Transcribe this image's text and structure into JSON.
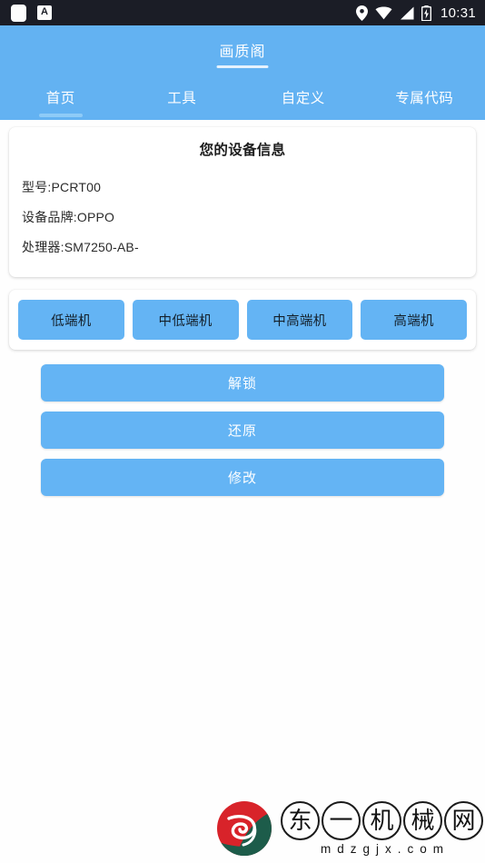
{
  "status_bar": {
    "left_icons": [
      "app-square-icon",
      "a-badge-icon"
    ],
    "a_badge_label": "A",
    "right_icons": [
      "location-pin-icon",
      "wifi-icon",
      "cellular-signal-icon",
      "battery-charging-icon"
    ],
    "clock": "10:31"
  },
  "app_bar": {
    "title": "画质阁"
  },
  "tabs": [
    {
      "label": "首页",
      "active": true
    },
    {
      "label": "工具",
      "active": false
    },
    {
      "label": "自定义",
      "active": false
    },
    {
      "label": "专属代码",
      "active": false
    }
  ],
  "device_info": {
    "title": "您的设备信息",
    "rows": [
      "型号:PCRT00",
      "设备品牌:OPPO",
      "处理器:SM7250-AB-"
    ]
  },
  "tier_buttons": [
    {
      "label": "低端机"
    },
    {
      "label": "中低端机"
    },
    {
      "label": "中高端机"
    },
    {
      "label": "高端机"
    }
  ],
  "action_buttons": [
    {
      "label": "解锁"
    },
    {
      "label": "还原"
    },
    {
      "label": "修改"
    }
  ],
  "watermark": {
    "emblem": "dongyi-logo-icon",
    "characters": [
      "东",
      "一",
      "机",
      "械",
      "网"
    ],
    "url": "mdzgjx.com"
  },
  "colors": {
    "status_bar_bg": "#1b1d26",
    "app_bar_blue": "#63b2f2",
    "button_blue": "#64b4f4",
    "tab_indicator": "#8ecbf7",
    "title_underline": "#e6f2fd",
    "page_bg": "#fefefe",
    "card_bg": "#ffffff",
    "tier_text": "#14202b",
    "action_text": "#ffffff",
    "logo_red": "#d8232a",
    "logo_green": "#1d5c4a"
  }
}
